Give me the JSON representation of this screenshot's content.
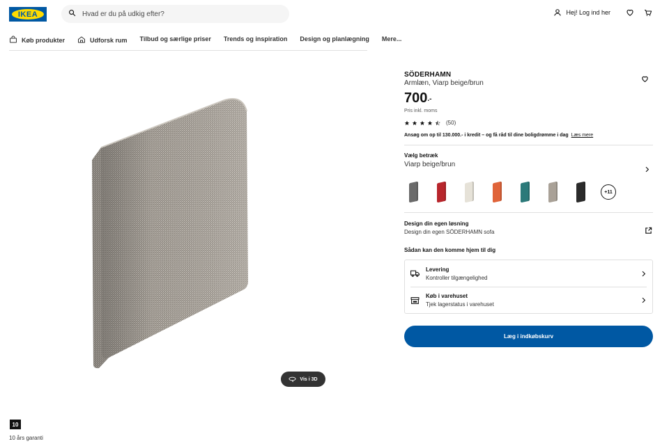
{
  "header": {
    "logo_text": "IKEA",
    "search_placeholder": "Hvad er du på udkig efter?",
    "login_label": "Hej! Log ind her"
  },
  "nav": {
    "items": [
      {
        "label": "Køb produkter",
        "icon": "shopping-bag-icon"
      },
      {
        "label": "Udforsk rum",
        "icon": "home-icon"
      },
      {
        "label": "Tilbud og særlige priser"
      },
      {
        "label": "Trends og inspiration"
      },
      {
        "label": "Design og planlægning"
      },
      {
        "label": "Mere..."
      }
    ]
  },
  "gallery": {
    "view_3d_label": "Vis i 3D",
    "warranty_badge": "10",
    "warranty_text": "10 års garanti"
  },
  "product": {
    "name": "SÖDERHAMN",
    "description": "Armlæn, Viarp beige/brun",
    "price_integer": "700",
    "price_decimal": ".-",
    "price_note": "Pris inkl. moms",
    "rating_value": 4.5,
    "rating_count": "(50)",
    "credit_text": "Ansøg om op til 130.000.- i kredit – og få råd til dine boligdrømme i dag",
    "credit_link": "Læs mere",
    "cover_label": "Vælg betræk",
    "cover_value": "Viarp beige/brun",
    "swatch_colors": [
      "#6b6b6b",
      "#b8262c",
      "#e6e2d8",
      "#e0643a",
      "#2c7a7a",
      "#a9a197",
      "#2b2b2b"
    ],
    "swatch_more": "+11",
    "design_title": "Design din egen løsning",
    "design_sub": "Design din egen SÖDERHAMN sofa",
    "home_title": "Sådan kan den komme hjem til dig",
    "delivery_title": "Levering",
    "delivery_sub": "Kontroller tilgængelighed",
    "store_title": "Køb i varehuset",
    "store_sub": "Tjek lagerstatus i varehuset",
    "add_to_cart": "Læg i indkøbskurv"
  },
  "colors": {
    "brand_blue": "#0058a3",
    "brand_yellow": "#ffdb00"
  }
}
